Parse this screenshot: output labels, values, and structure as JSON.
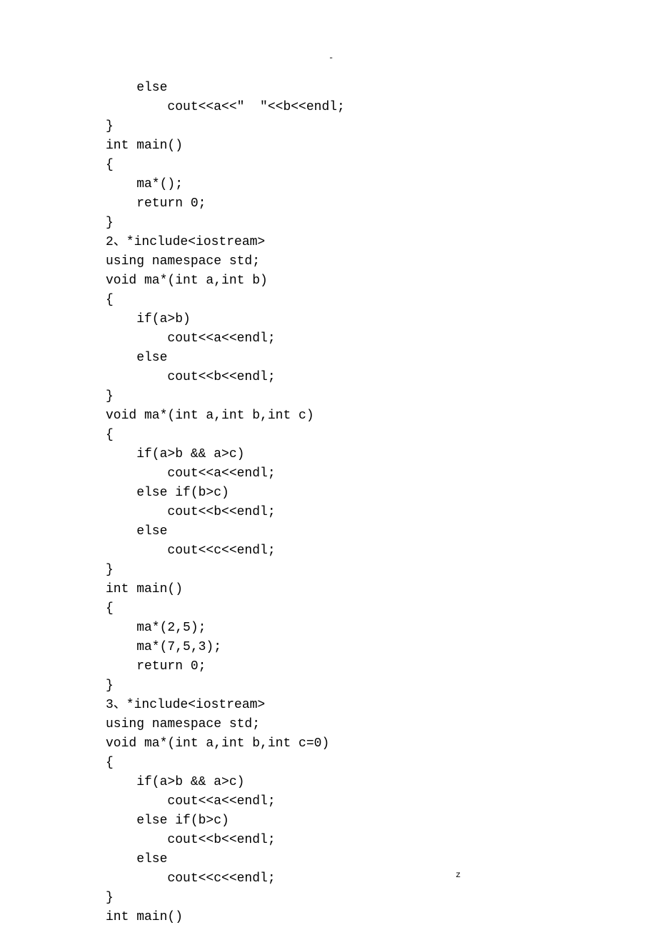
{
  "header_mark": "-",
  "code": {
    "lines": [
      "    else",
      "        cout<<a<<\"  \"<<b<<endl;",
      "}",
      "int main()",
      "{",
      "    ma*();",
      "    return 0;",
      "}",
      "2、*include<iostream>",
      "using namespace std;",
      "void ma*(int a,int b)",
      "{",
      "    if(a>b)",
      "        cout<<a<<endl;",
      "    else",
      "        cout<<b<<endl;",
      "}",
      "void ma*(int a,int b,int c)",
      "{",
      "    if(a>b && a>c)",
      "        cout<<a<<endl;",
      "    else if(b>c)",
      "        cout<<b<<endl;",
      "    else",
      "        cout<<c<<endl;",
      "}",
      "int main()",
      "{",
      "    ma*(2,5);",
      "    ma*(7,5,3);",
      "    return 0;",
      "}",
      "3、*include<iostream>",
      "using namespace std;",
      "void ma*(int a,int b,int c=0)",
      "{",
      "    if(a>b && a>c)",
      "        cout<<a<<endl;",
      "    else if(b>c)",
      "        cout<<b<<endl;",
      "    else",
      "        cout<<c<<endl;",
      "}",
      "int main()"
    ]
  },
  "footer": {
    "dot": ".",
    "z": "z"
  }
}
